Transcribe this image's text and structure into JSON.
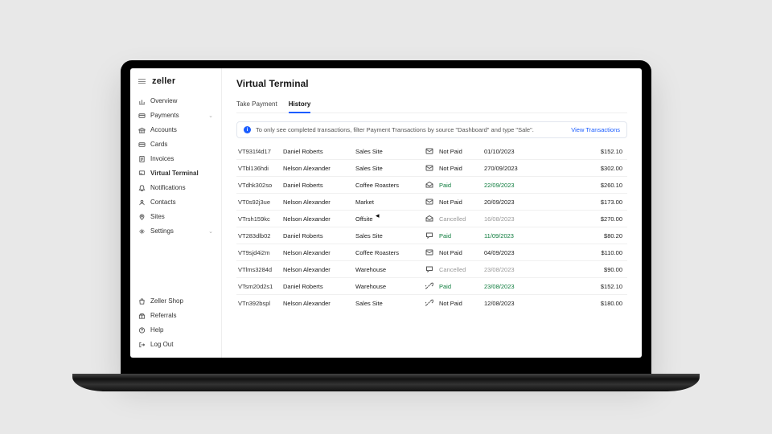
{
  "brand": "zeller",
  "sidebar": {
    "items": [
      {
        "icon": "chart",
        "label": "Overview"
      },
      {
        "icon": "card",
        "label": "Payments",
        "chev": true
      },
      {
        "icon": "bank",
        "label": "Accounts"
      },
      {
        "icon": "card",
        "label": "Cards"
      },
      {
        "icon": "doc",
        "label": "Invoices"
      },
      {
        "icon": "terminal",
        "label": "Virtual Terminal"
      },
      {
        "icon": "bell",
        "label": "Notifications"
      },
      {
        "icon": "user",
        "label": "Contacts"
      },
      {
        "icon": "pin",
        "label": "Sites"
      },
      {
        "icon": "gear",
        "label": "Settings",
        "chev": true
      }
    ],
    "footer": [
      {
        "icon": "bag",
        "label": "Zeller Shop"
      },
      {
        "icon": "gift",
        "label": "Referrals"
      },
      {
        "icon": "help",
        "label": "Help"
      },
      {
        "icon": "logout",
        "label": "Log Out"
      }
    ]
  },
  "page": {
    "title": "Virtual Terminal",
    "tabs": [
      "Take Payment",
      "History"
    ],
    "active_tab": 1,
    "notice_text": "To only see completed transactions, filter Payment Transactions by source \"Dashboard\" and type \"Sale\".",
    "notice_link": "View Transactions"
  },
  "rows": [
    {
      "id": "VT931f4d17",
      "name": "Daniel Roberts",
      "site": "Sales Site",
      "icon": "mail",
      "status": "Not Paid",
      "statusClass": "",
      "date": "01/10/2023",
      "dateClass": "",
      "amount": "$152.10"
    },
    {
      "id": "VTbl136hdi",
      "name": "Nelson Alexander",
      "site": "Sales Site",
      "icon": "mail",
      "status": "Not Paid",
      "statusClass": "",
      "date": "270/09/2023",
      "dateClass": "",
      "amount": "$302.00"
    },
    {
      "id": "VTdhk302so",
      "name": "Daniel Roberts",
      "site": "Coffee Roasters",
      "icon": "mail-open",
      "status": "Paid",
      "statusClass": "paid",
      "date": "22/09/2023",
      "dateClass": "paid-date",
      "amount": "$260.10"
    },
    {
      "id": "VT0s92j3ue",
      "name": "Nelson Alexander",
      "site": "Market",
      "icon": "mail",
      "status": "Not Paid",
      "statusClass": "",
      "date": "20/09/2023",
      "dateClass": "",
      "amount": "$173.00"
    },
    {
      "id": "VTrsh159kc",
      "name": "Nelson Alexander",
      "site": "Offsite",
      "icon": "mail-open",
      "status": "Cancelled",
      "statusClass": "cancelled",
      "date": "16/08/2023",
      "dateClass": "cancelled-date",
      "amount": "$270.00"
    },
    {
      "id": "VT283dlb02",
      "name": "Daniel Roberts",
      "site": "Sales Site",
      "icon": "chat",
      "status": "Paid",
      "statusClass": "paid",
      "date": "11/09/2023",
      "dateClass": "paid-date",
      "amount": "$80.20"
    },
    {
      "id": "VT9sjd4i2m",
      "name": "Nelson Alexander",
      "site": "Coffee Roasters",
      "icon": "mail",
      "status": "Not Paid",
      "statusClass": "",
      "date": "04/09/2023",
      "dateClass": "",
      "amount": "$110.00"
    },
    {
      "id": "VTlms3284d",
      "name": "Nelson Alexander",
      "site": "Warehouse",
      "icon": "chat",
      "status": "Cancelled",
      "statusClass": "cancelled",
      "date": "23/08/2023",
      "dateClass": "cancelled-date",
      "amount": "$90.00"
    },
    {
      "id": "VTsm20d2s1",
      "name": "Daniel Roberts",
      "site": "Warehouse",
      "icon": "link",
      "status": "Paid",
      "statusClass": "paid",
      "date": "23/08/2023",
      "dateClass": "paid-date",
      "amount": "$152.10"
    },
    {
      "id": "VTn392bspl",
      "name": "Nelson Alexander",
      "site": "Sales Site",
      "icon": "link",
      "status": "Not Paid",
      "statusClass": "",
      "date": "12/08/2023",
      "dateClass": "",
      "amount": "$180.00"
    }
  ]
}
